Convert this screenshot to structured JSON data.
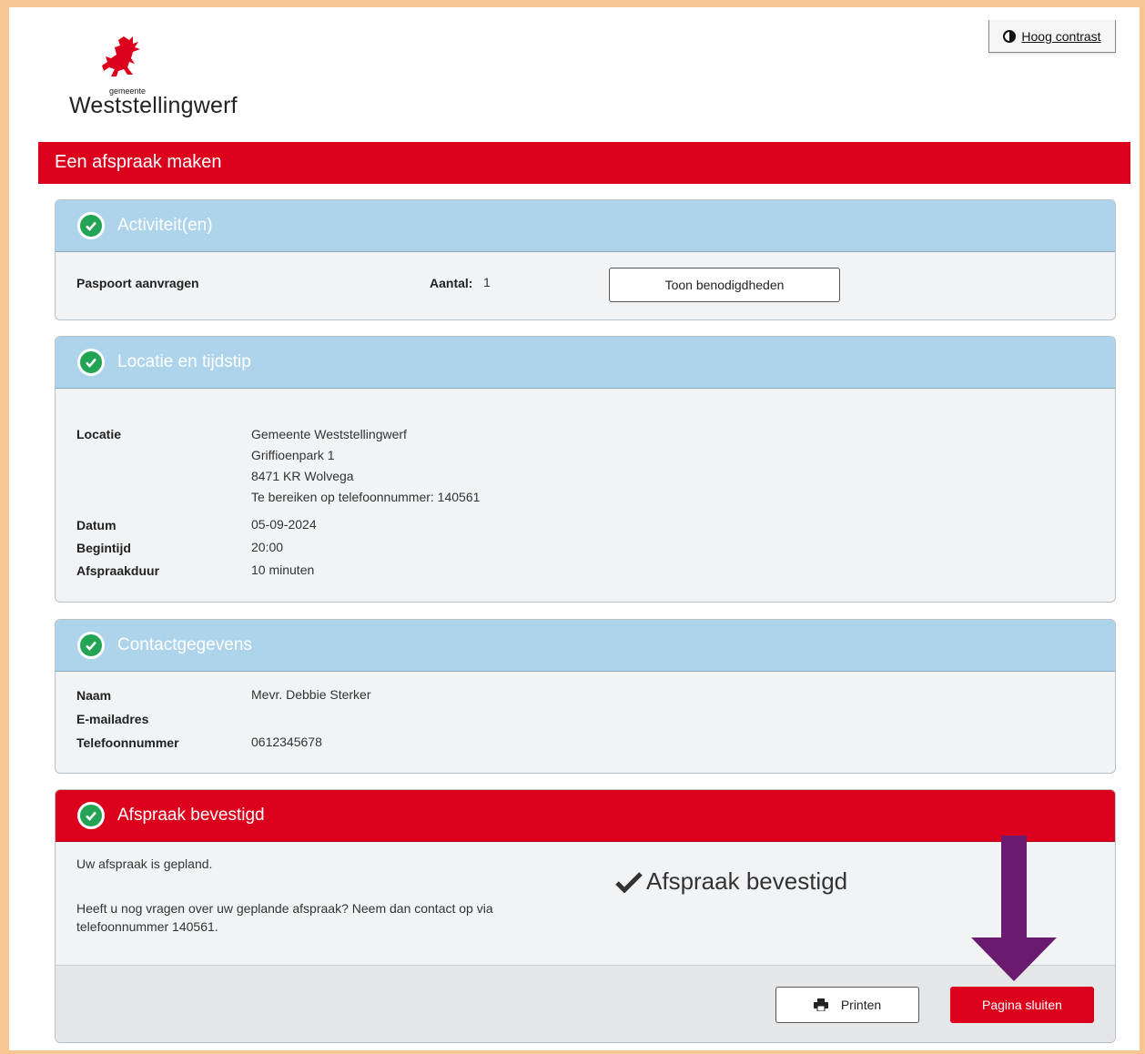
{
  "header": {
    "contrast_label": "Hoog contrast",
    "logo_small": "gemeente",
    "logo_name": "Weststellingwerf"
  },
  "title_bar": "Een afspraak maken",
  "activities": {
    "title": "Activiteit(en)",
    "item": "Paspoort aanvragen",
    "count_label": "Aantal:",
    "count_value": "1",
    "button_label": "Toon benodigdheden"
  },
  "location": {
    "title": "Locatie en tijdstip",
    "location_label": "Locatie",
    "address_lines": [
      "Gemeente Weststellingwerf",
      "Griffioenpark 1",
      "8471 KR Wolvega",
      "Te bereiken op telefoonnummer: 140561"
    ],
    "date_label": "Datum",
    "date_value": "05-09-2024",
    "start_label": "Begintijd",
    "start_value": "20:00",
    "duration_label": "Afspraakduur",
    "duration_value": "10 minuten"
  },
  "contact": {
    "title": "Contactgegevens",
    "name_label": "Naam",
    "name_value": "Mevr. Debbie Sterker",
    "email_label": "E-mailadres",
    "email_value": "",
    "phone_label": "Telefoonnummer",
    "phone_value": "0612345678"
  },
  "confirmation": {
    "title": "Afspraak bevestigd",
    "text1": "Uw afspraak is gepland.",
    "text2": "Heeft u nog vragen over uw geplande afspraak? Neem dan contact op via telefoonnummer 140561.",
    "badge": "Afspraak bevestigd",
    "print_label": "Printen",
    "close_label": "Pagina sluiten"
  },
  "colors": {
    "brand_red": "#dc001c",
    "panel_blue": "#add4eb",
    "check_green": "#23a455",
    "arrow_purple": "#6a1b70",
    "frame": "#f7c792"
  },
  "icons": [
    "contrast-icon",
    "griffin-logo",
    "check-circle-icon",
    "checkmark-icon",
    "printer-icon",
    "arrow-down-icon"
  ]
}
